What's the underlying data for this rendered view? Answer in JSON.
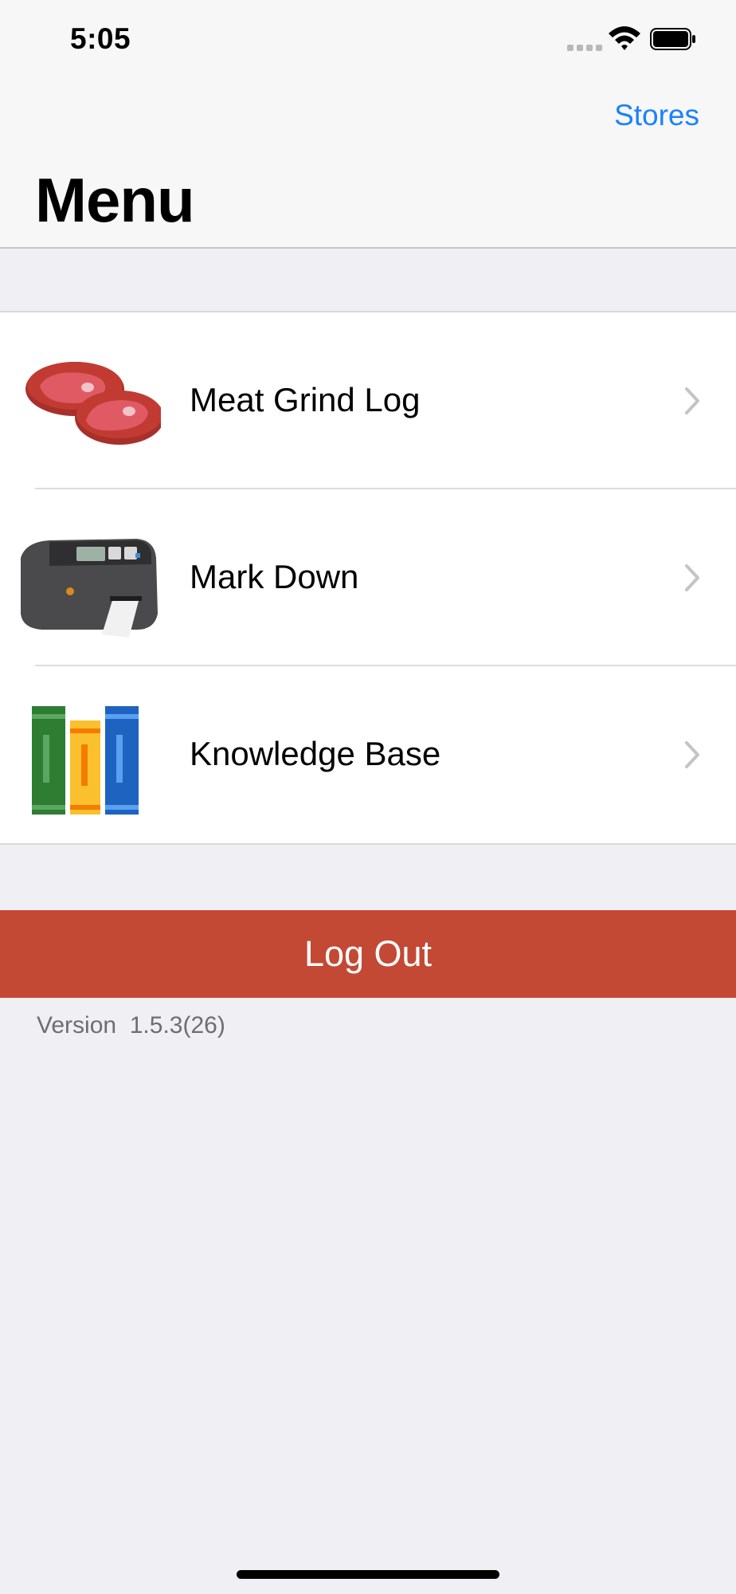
{
  "status_bar": {
    "time": "5:05"
  },
  "nav": {
    "right_button": "Stores",
    "title": "Menu"
  },
  "menu_items": [
    {
      "label": "Meat Grind Log",
      "icon": "meat-steaks-icon"
    },
    {
      "label": "Mark Down",
      "icon": "label-printer-icon"
    },
    {
      "label": "Knowledge Base",
      "icon": "books-icon"
    }
  ],
  "logout": {
    "label": "Log Out",
    "color": "#c34935"
  },
  "version": {
    "text": "Version  1.5.3(26)"
  },
  "colors": {
    "accent": "#1a82fb",
    "background": "#efeff4"
  }
}
